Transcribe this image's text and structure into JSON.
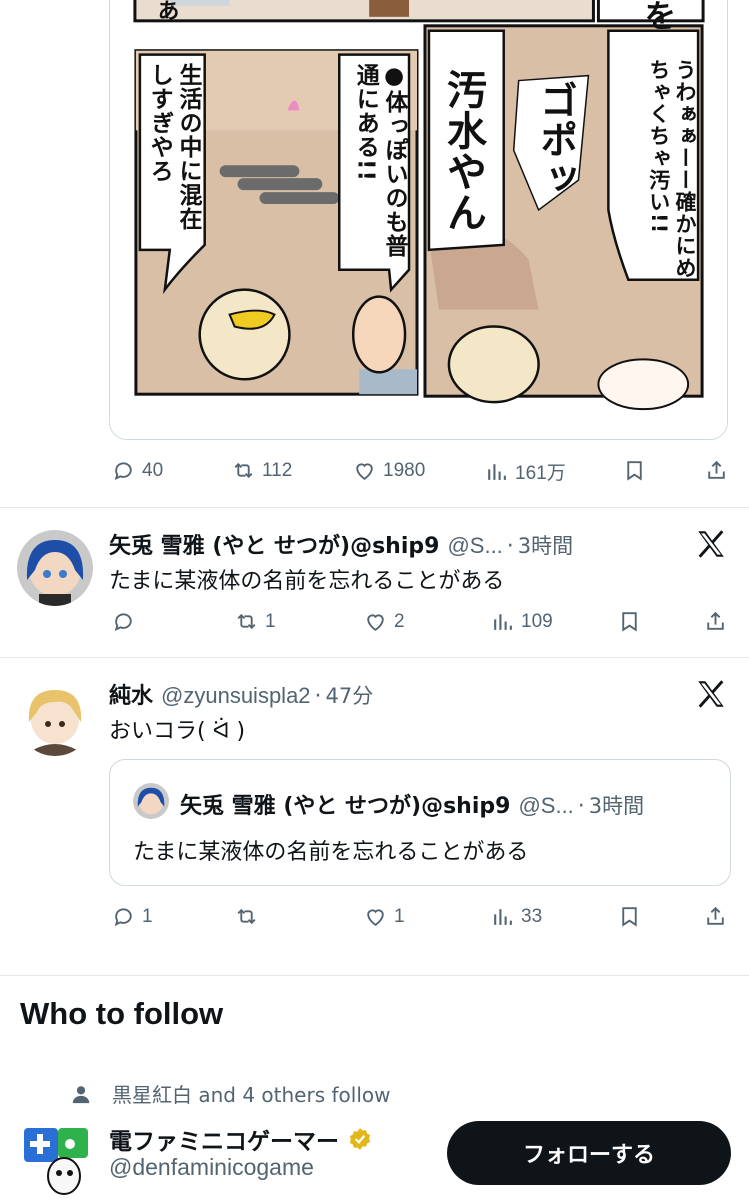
{
  "tweets": [
    {
      "comic_text": {
        "top_right_fragment": "を",
        "top_left_fragment": "あ",
        "panel_right_speech": "うわぁぁーー確かにめちゃくちゃ汚い!!",
        "panel_right_sfx": "ゴポッ",
        "panel_right_shout": "汚水やん",
        "panel_left_speech": "●体っぽいのも普通にある!!",
        "panel_left_caption": "生活の中に混在しすぎやろ"
      },
      "metrics": {
        "replies": "40",
        "reposts": "112",
        "likes": "1980",
        "views": "161万"
      }
    },
    {
      "name": "矢兎 雪雅 (やと せつが)@ship9",
      "handle": "@S...",
      "time": "3時間",
      "text": "たまに某液体の名前を忘れることがある",
      "metrics": {
        "replies": "",
        "reposts": "1",
        "likes": "2",
        "views": "109"
      }
    },
    {
      "name": "純水",
      "handle": "@zyunsuispla2",
      "time": "47分",
      "text": "おいコラ( ᐛ )",
      "quote": {
        "name": "矢兎 雪雅 (やと せつが)@ship9",
        "handle": "@S...",
        "time": "3時間",
        "text": "たまに某液体の名前を忘れることがある"
      },
      "metrics": {
        "replies": "1",
        "reposts": "",
        "likes": "1",
        "views": "33"
      }
    }
  ],
  "who_to_follow": {
    "title": "Who to follow",
    "social_context": "黒星紅白 and 4 others follow",
    "account": {
      "name": "電ファミニコゲーマー",
      "handle": "@denfaminicogame",
      "follow_label": "フォローする",
      "verified": true
    }
  },
  "colors": {
    "text": "#0f1419",
    "secondary": "#536471",
    "border": "#cfd9de",
    "gold_badge": "#e2b719"
  },
  "icons": [
    "reply-icon",
    "repost-icon",
    "like-icon",
    "views-icon",
    "bookmark-icon",
    "share-icon",
    "x-logo-icon",
    "person-icon",
    "verified-badge-icon"
  ]
}
